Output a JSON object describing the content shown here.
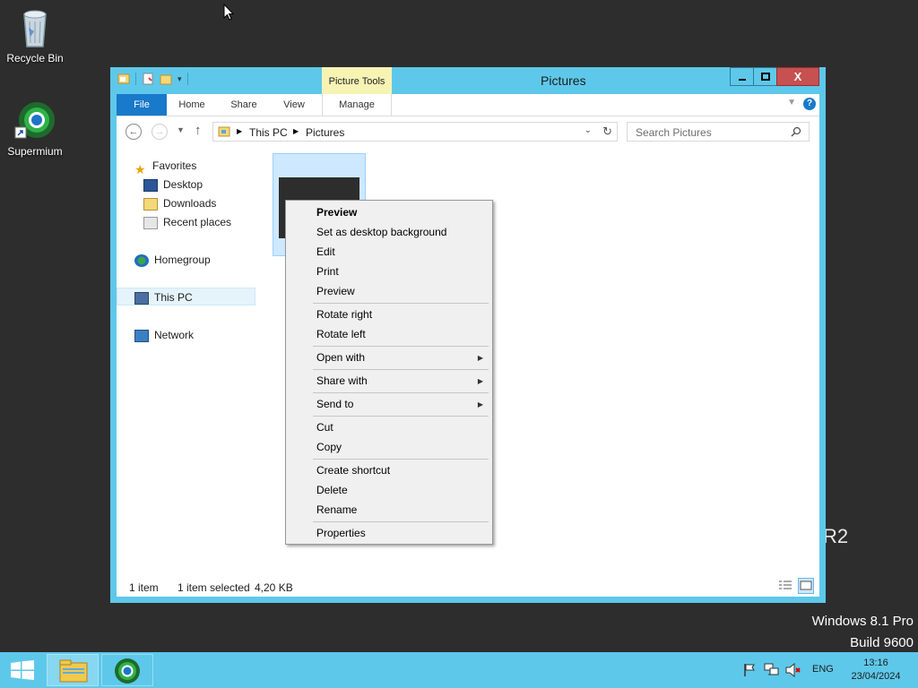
{
  "desktop": {
    "icons": [
      {
        "label": "Recycle Bin",
        "icon": "recycle-bin-icon"
      },
      {
        "label": "Supermium",
        "icon": "supermium-icon"
      }
    ],
    "watermark_os": "Windows 8.1 Pro",
    "watermark_build": "Build 9600",
    "watermark_fragment": "R2"
  },
  "window": {
    "title": "Pictures",
    "contextual_group": "Picture Tools",
    "controls": {
      "minimize": "minimize-icon",
      "maximize": "maximize-icon",
      "close": "X"
    },
    "ribbon_tabs": [
      "File",
      "Home",
      "Share",
      "View",
      "Manage"
    ],
    "help": "?",
    "address": {
      "crumbs": [
        "This PC",
        "Pictures"
      ]
    },
    "search": {
      "placeholder": "Search Pictures"
    },
    "nav_pane": {
      "favorites": "Favorites",
      "favorites_items": [
        "Desktop",
        "Downloads",
        "Recent places"
      ],
      "homegroup": "Homegroup",
      "this_pc": "This PC",
      "network": "Network"
    },
    "status": {
      "count": "1 item",
      "selected": "1 item selected",
      "size": "4,20 KB"
    }
  },
  "context_menu": {
    "items": [
      {
        "label": "Preview",
        "bold": true
      },
      {
        "label": "Set as desktop background"
      },
      {
        "label": "Edit"
      },
      {
        "label": "Print"
      },
      {
        "label": "Preview"
      },
      {
        "label": "Rotate right"
      },
      {
        "label": "Rotate left"
      },
      {
        "label": "Open with",
        "submenu": true
      },
      {
        "label": "Share with",
        "submenu": true
      },
      {
        "label": "Send to",
        "submenu": true
      },
      {
        "label": "Cut"
      },
      {
        "label": "Copy"
      },
      {
        "label": "Create shortcut"
      },
      {
        "label": "Delete"
      },
      {
        "label": "Rename"
      },
      {
        "label": "Properties"
      }
    ]
  },
  "taskbar": {
    "lang": "ENG",
    "time": "13:16",
    "date": "23/04/2024"
  },
  "colors": {
    "window_frame": "#5ec8ea",
    "file_tab": "#1979ca",
    "contextual_tab": "#f7f3b4",
    "desktop": "#2d2d2d",
    "close_button": "#c75050"
  }
}
